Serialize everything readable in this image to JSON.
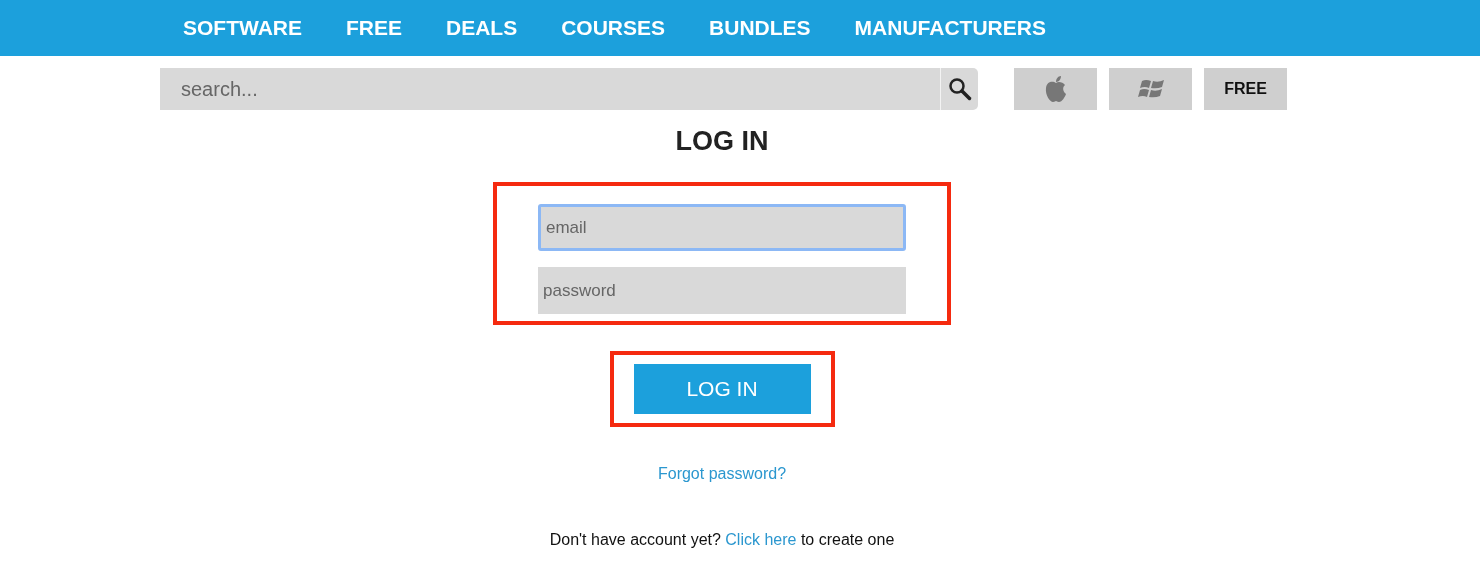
{
  "nav": {
    "items": [
      "SOFTWARE",
      "FREE",
      "DEALS",
      "COURSES",
      "BUNDLES",
      "MANUFACTURERS"
    ]
  },
  "search": {
    "placeholder": "search..."
  },
  "platforms": [
    {
      "kind": "apple"
    },
    {
      "kind": "windows"
    },
    {
      "kind": "text",
      "label": "FREE"
    }
  ],
  "title": "LOG IN",
  "fields": [
    {
      "placeholder": "email",
      "focused": true
    },
    {
      "placeholder": "password",
      "focused": false
    }
  ],
  "login_button": "LOG IN",
  "forgot_link": "Forgot password?",
  "signup": {
    "before": "Don't have account yet?",
    "link": "Click here",
    "after": "to create one"
  }
}
